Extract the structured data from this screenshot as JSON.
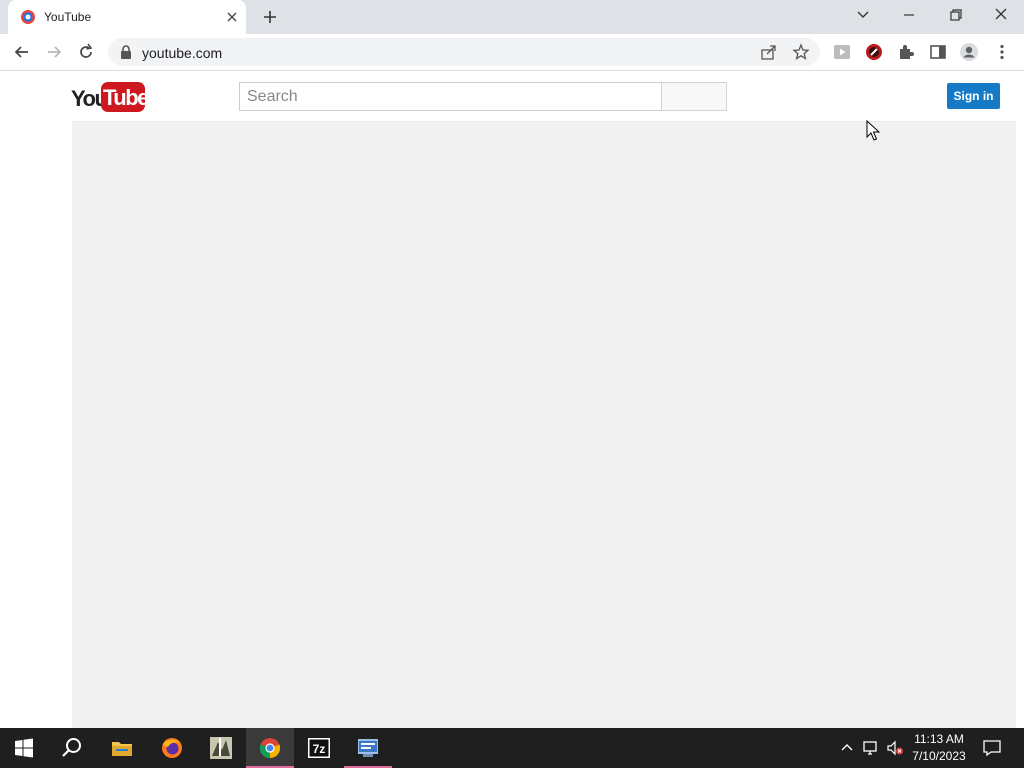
{
  "browser": {
    "tab": {
      "title": "YouTube",
      "favicon": "record-icon"
    },
    "toolbar": {
      "url": "youtube.com"
    },
    "icons": [
      "back-arrow-icon",
      "forward-arrow-icon",
      "reload-icon",
      "lock-icon",
      "share-icon",
      "star-icon",
      "extension-play-icon",
      "extension-red-icon",
      "puzzle-icon",
      "side-panel-icon",
      "profile-icon",
      "kebab-menu-icon"
    ]
  },
  "youtube": {
    "logo_you": "You",
    "logo_tube": "Tube",
    "search_placeholder": "Search",
    "signin_label": "Sign in",
    "colors": {
      "logo_red": "#cc181e",
      "signin_blue": "#167ac6",
      "content_bg": "#f1f1f1"
    }
  },
  "taskbar": {
    "apps": [
      "start-icon",
      "search-icon",
      "file-explorer-icon",
      "firefox-icon",
      "app-icon",
      "chrome-icon",
      "7zip-icon",
      "app2-icon"
    ],
    "seven_zip_label": "7z",
    "clock": {
      "time": "11:13 AM",
      "date": "7/10/2023"
    }
  }
}
